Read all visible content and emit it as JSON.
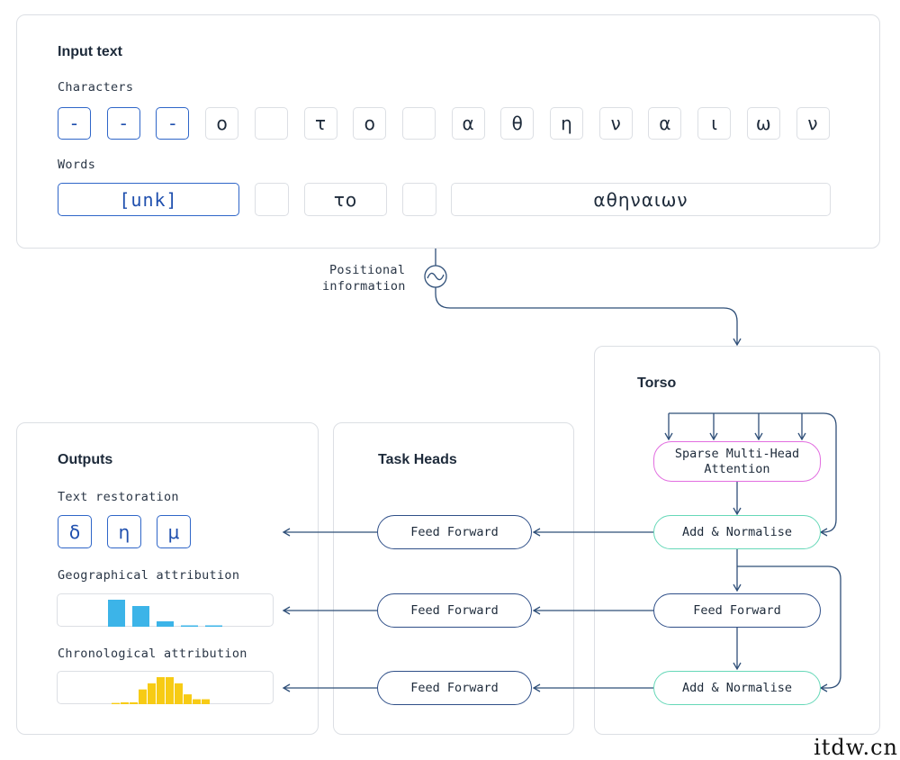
{
  "input": {
    "title": "Input text",
    "characters_label": "Characters",
    "characters": [
      {
        "text": "-",
        "highlight": true
      },
      {
        "text": "-",
        "highlight": true
      },
      {
        "text": "-",
        "highlight": true
      },
      {
        "text": "ο",
        "highlight": false
      },
      {
        "text": "",
        "highlight": false
      },
      {
        "text": "τ",
        "highlight": false
      },
      {
        "text": "ο",
        "highlight": false
      },
      {
        "text": "",
        "highlight": false
      },
      {
        "text": "α",
        "highlight": false
      },
      {
        "text": "θ",
        "highlight": false
      },
      {
        "text": "η",
        "highlight": false
      },
      {
        "text": "ν",
        "highlight": false
      },
      {
        "text": "α",
        "highlight": false
      },
      {
        "text": "ι",
        "highlight": false
      },
      {
        "text": "ω",
        "highlight": false
      },
      {
        "text": "ν",
        "highlight": false
      }
    ],
    "words_label": "Words",
    "words": [
      {
        "text": "[unk]",
        "highlight": true
      },
      {
        "text": "",
        "highlight": false
      },
      {
        "text": "το",
        "highlight": false
      },
      {
        "text": "",
        "highlight": false
      },
      {
        "text": "αθηναιων",
        "highlight": false
      }
    ]
  },
  "positional": {
    "line1": "Positional",
    "line2": "information"
  },
  "torso": {
    "title": "Torso",
    "attention_line1": "Sparse Multi-Head",
    "attention_line2": "Attention",
    "add_norm_1": "Add & Normalise",
    "feed_forward": "Feed Forward",
    "add_norm_2": "Add & Normalise"
  },
  "task_heads": {
    "title": "Task Heads",
    "ff1": "Feed Forward",
    "ff2": "Feed Forward",
    "ff3": "Feed Forward"
  },
  "outputs": {
    "title": "Outputs",
    "text_restoration_label": "Text restoration",
    "restored": [
      "δ",
      "η",
      "μ"
    ],
    "geo_label": "Geographical attribution",
    "geo_values": [
      30,
      23,
      6,
      1.5,
      1.5
    ],
    "geo_color": "#3cb4e8",
    "chrono_label": "Chronological attribution",
    "chrono_values": [
      1,
      1.5,
      1.5,
      12,
      17,
      22,
      22,
      17,
      8,
      4,
      4
    ],
    "chrono_color": "#f7cb15"
  },
  "colors": {
    "highlight_blue": "#2f66c8",
    "wire": "#2f4f78",
    "teal": "#66d8b8",
    "pink": "#e26ee0"
  },
  "watermark": "itdw.cn"
}
